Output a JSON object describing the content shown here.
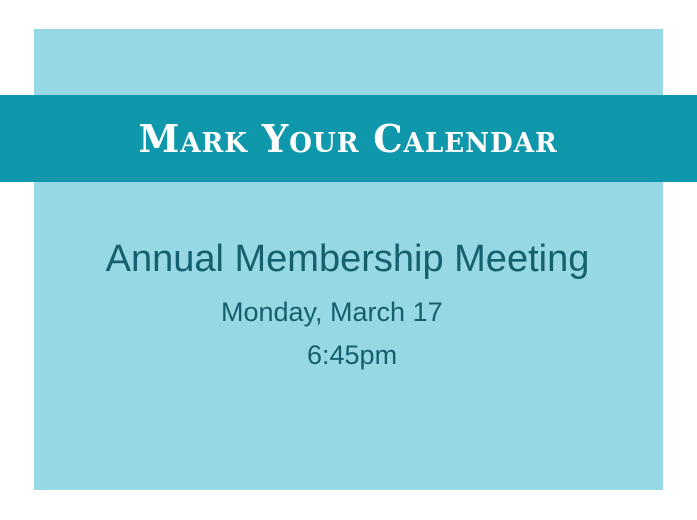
{
  "colors": {
    "page_background": "#ffffff",
    "card_background": "#97d8e5",
    "banner_background": "#0f97ab",
    "banner_text": "#ffffff",
    "body_text": "#15606f"
  },
  "banner": {
    "title": "Mark Your Calendar"
  },
  "event": {
    "name": "Annual Membership Meeting",
    "date": "Monday, March 17",
    "time": "6:45pm"
  }
}
